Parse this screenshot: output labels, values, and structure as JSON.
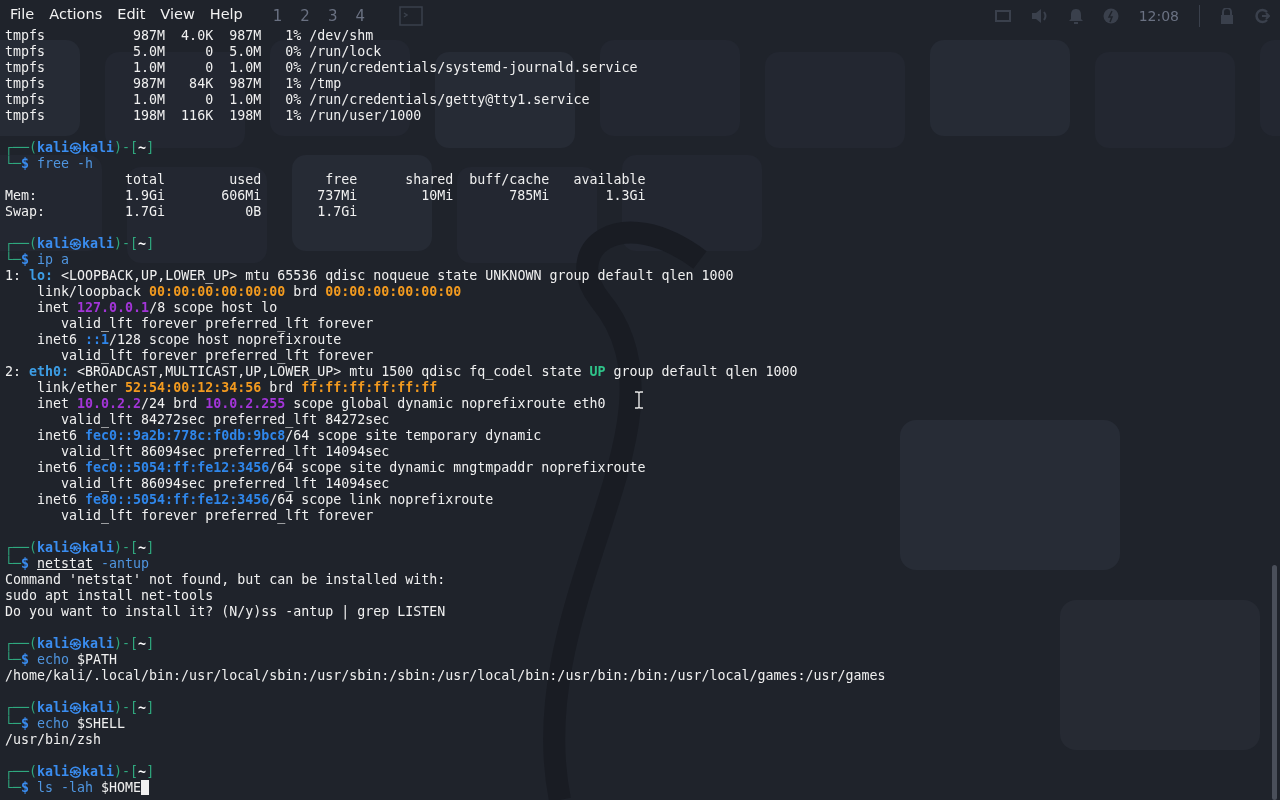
{
  "menu": [
    {
      "label": "File"
    },
    {
      "label": "Actions"
    },
    {
      "label": "Edit"
    },
    {
      "label": "View"
    },
    {
      "label": "Help"
    }
  ],
  "panel": {
    "workspaces": [
      "1",
      "2",
      "3",
      "4"
    ],
    "clock": "12:08"
  },
  "terminal": {
    "blocks": [
      {
        "lines": [
          {
            "segments": [
              {
                "text": "tmpfs           987M  4.0K  987M   1% /dev/shm",
                "kind": "plain"
              }
            ]
          },
          {
            "segments": [
              {
                "text": "tmpfs           5.0M     0  5.0M   0% /run/lock",
                "kind": "plain"
              }
            ]
          },
          {
            "segments": [
              {
                "text": "tmpfs           1.0M     0  1.0M   0% /run/credentials/systemd-journald.service",
                "kind": "plain"
              }
            ]
          },
          {
            "segments": [
              {
                "text": "tmpfs           987M   84K  987M   1% /tmp",
                "kind": "plain"
              }
            ]
          },
          {
            "segments": [
              {
                "text": "tmpfs           1.0M     0  1.0M   0% /run/credentials/getty@tty1.service",
                "kind": "plain"
              }
            ]
          },
          {
            "segments": [
              {
                "text": "tmpfs           198M  116K  198M   1% /run/user/1000",
                "kind": "plain"
              }
            ]
          }
        ]
      },
      {
        "lines": [
          {
            "segments": [
              {
                "text": "┌──(",
                "kind": "frame"
              },
              {
                "text": "kali㉿kali",
                "kind": "user"
              },
              {
                "text": ")-[",
                "kind": "frame"
              },
              {
                "text": "~",
                "kind": "dir"
              },
              {
                "text": "]",
                "kind": "frame"
              }
            ]
          },
          {
            "segments": [
              {
                "text": "└─",
                "kind": "frame"
              },
              {
                "text": "$ ",
                "kind": "dollar"
              },
              {
                "text": "free -h",
                "kind": "cmd"
              }
            ]
          },
          {
            "segments": [
              {
                "text": "               total        used        free      shared  buff/cache   available",
                "kind": "plain"
              }
            ]
          },
          {
            "segments": [
              {
                "text": "Mem:           1.9Gi       606Mi       737Mi        10Mi       785Mi       1.3Gi",
                "kind": "plain"
              }
            ]
          },
          {
            "segments": [
              {
                "text": "Swap:          1.7Gi          0B       1.7Gi",
                "kind": "plain"
              }
            ]
          }
        ]
      },
      {
        "lines": [
          {
            "segments": [
              {
                "text": "┌──(",
                "kind": "frame"
              },
              {
                "text": "kali㉿kali",
                "kind": "user"
              },
              {
                "text": ")-[",
                "kind": "frame"
              },
              {
                "text": "~",
                "kind": "dir"
              },
              {
                "text": "]",
                "kind": "frame"
              }
            ]
          },
          {
            "segments": [
              {
                "text": "└─",
                "kind": "frame"
              },
              {
                "text": "$ ",
                "kind": "dollar"
              },
              {
                "text": "ip a",
                "kind": "cmd"
              }
            ]
          },
          {
            "segments": [
              {
                "text": "1: ",
                "kind": "plain"
              },
              {
                "text": "lo:",
                "kind": "iface"
              },
              {
                "text": " <LOOPBACK,UP,LOWER_UP> mtu 65536 qdisc noqueue state UNKNOWN group default qlen 1000",
                "kind": "plain"
              }
            ]
          },
          {
            "segments": [
              {
                "text": "    link/loopback ",
                "kind": "plain"
              },
              {
                "text": "00:00:00:00:00:00",
                "kind": "mac"
              },
              {
                "text": " brd ",
                "kind": "plain"
              },
              {
                "text": "00:00:00:00:00:00",
                "kind": "mac"
              }
            ]
          },
          {
            "segments": [
              {
                "text": "    inet ",
                "kind": "plain"
              },
              {
                "text": "127.0.0.1",
                "kind": "ipv4"
              },
              {
                "text": "/8 scope host lo",
                "kind": "plain"
              }
            ]
          },
          {
            "segments": [
              {
                "text": "       valid_lft forever preferred_lft forever",
                "kind": "plain"
              }
            ]
          },
          {
            "segments": [
              {
                "text": "    inet6 ",
                "kind": "plain"
              },
              {
                "text": "::1",
                "kind": "ipv6"
              },
              {
                "text": "/128 scope host noprefixroute",
                "kind": "plain"
              }
            ]
          },
          {
            "segments": [
              {
                "text": "       valid_lft forever preferred_lft forever",
                "kind": "plain"
              }
            ]
          },
          {
            "segments": [
              {
                "text": "2: ",
                "kind": "plain"
              },
              {
                "text": "eth0:",
                "kind": "iface"
              },
              {
                "text": " <BROADCAST,MULTICAST,UP,LOWER_UP> mtu 1500 qdisc fq_codel state ",
                "kind": "plain"
              },
              {
                "text": "UP",
                "kind": "up"
              },
              {
                "text": " group default qlen 1000",
                "kind": "plain"
              }
            ]
          },
          {
            "segments": [
              {
                "text": "    link/ether ",
                "kind": "plain"
              },
              {
                "text": "52:54:00:12:34:56",
                "kind": "mac"
              },
              {
                "text": " brd ",
                "kind": "plain"
              },
              {
                "text": "ff:ff:ff:ff:ff:ff",
                "kind": "mac"
              }
            ]
          },
          {
            "segments": [
              {
                "text": "    inet ",
                "kind": "plain"
              },
              {
                "text": "10.0.2.2",
                "kind": "ipv4"
              },
              {
                "text": "/24 brd ",
                "kind": "plain"
              },
              {
                "text": "10.0.2.255",
                "kind": "ipv4"
              },
              {
                "text": " scope global dynamic noprefixroute eth0",
                "kind": "plain"
              }
            ]
          },
          {
            "segments": [
              {
                "text": "       valid_lft 84272sec preferred_lft 84272sec",
                "kind": "plain"
              }
            ]
          },
          {
            "segments": [
              {
                "text": "    inet6 ",
                "kind": "plain"
              },
              {
                "text": "fec0::9a2b:778c:f0db:9bc8",
                "kind": "ipv6"
              },
              {
                "text": "/64 scope site temporary dynamic",
                "kind": "plain"
              }
            ]
          },
          {
            "segments": [
              {
                "text": "       valid_lft 86094sec preferred_lft 14094sec",
                "kind": "plain"
              }
            ]
          },
          {
            "segments": [
              {
                "text": "    inet6 ",
                "kind": "plain"
              },
              {
                "text": "fec0::5054:ff:fe12:3456",
                "kind": "ipv6"
              },
              {
                "text": "/64 scope site dynamic mngtmpaddr noprefixroute",
                "kind": "plain"
              }
            ]
          },
          {
            "segments": [
              {
                "text": "       valid_lft 86094sec preferred_lft 14094sec",
                "kind": "plain"
              }
            ]
          },
          {
            "segments": [
              {
                "text": "    inet6 ",
                "kind": "plain"
              },
              {
                "text": "fe80::5054:ff:fe12:3456",
                "kind": "ipv6"
              },
              {
                "text": "/64 scope link noprefixroute",
                "kind": "plain"
              }
            ]
          },
          {
            "segments": [
              {
                "text": "       valid_lft forever preferred_lft forever",
                "kind": "plain"
              }
            ]
          }
        ]
      },
      {
        "lines": [
          {
            "segments": [
              {
                "text": "┌──(",
                "kind": "frame"
              },
              {
                "text": "kali㉿kali",
                "kind": "user"
              },
              {
                "text": ")-[",
                "kind": "frame"
              },
              {
                "text": "~",
                "kind": "dir"
              },
              {
                "text": "]",
                "kind": "frame"
              }
            ]
          },
          {
            "segments": [
              {
                "text": "└─",
                "kind": "frame"
              },
              {
                "text": "$ ",
                "kind": "dollar"
              },
              {
                "text": "netstat",
                "kind": "missing"
              },
              {
                "text": " -antup",
                "kind": "cmd"
              }
            ]
          },
          {
            "segments": [
              {
                "text": "Command 'netstat' not found, but can be installed with:",
                "kind": "plain"
              }
            ]
          },
          {
            "segments": [
              {
                "text": "sudo apt install net-tools",
                "kind": "plain"
              }
            ]
          },
          {
            "segments": [
              {
                "text": "Do you want to install it? (N/y)ss -antup | grep LISTEN",
                "kind": "plain"
              }
            ]
          }
        ]
      },
      {
        "lines": [
          {
            "segments": [
              {
                "text": "┌──(",
                "kind": "frame"
              },
              {
                "text": "kali㉿kali",
                "kind": "user"
              },
              {
                "text": ")-[",
                "kind": "frame"
              },
              {
                "text": "~",
                "kind": "dir"
              },
              {
                "text": "]",
                "kind": "frame"
              }
            ]
          },
          {
            "segments": [
              {
                "text": "└─",
                "kind": "frame"
              },
              {
                "text": "$ ",
                "kind": "dollar"
              },
              {
                "text": "echo",
                "kind": "cmd"
              },
              {
                "text": " $PATH",
                "kind": "var"
              }
            ]
          },
          {
            "segments": [
              {
                "text": "/home/kali/.local/bin:/usr/local/sbin:/usr/sbin:/sbin:/usr/local/bin:/usr/bin:/bin:/usr/local/games:/usr/games",
                "kind": "plain"
              }
            ]
          }
        ]
      },
      {
        "lines": [
          {
            "segments": [
              {
                "text": "┌──(",
                "kind": "frame"
              },
              {
                "text": "kali㉿kali",
                "kind": "user"
              },
              {
                "text": ")-[",
                "kind": "frame"
              },
              {
                "text": "~",
                "kind": "dir"
              },
              {
                "text": "]",
                "kind": "frame"
              }
            ]
          },
          {
            "segments": [
              {
                "text": "└─",
                "kind": "frame"
              },
              {
                "text": "$ ",
                "kind": "dollar"
              },
              {
                "text": "echo",
                "kind": "cmd"
              },
              {
                "text": " $SHELL",
                "kind": "var"
              }
            ]
          },
          {
            "segments": [
              {
                "text": "/usr/bin/zsh",
                "kind": "plain"
              }
            ]
          }
        ]
      },
      {
        "lines": [
          {
            "segments": [
              {
                "text": "┌──(",
                "kind": "frame"
              },
              {
                "text": "kali㉿kali",
                "kind": "user"
              },
              {
                "text": ")-[",
                "kind": "frame"
              },
              {
                "text": "~",
                "kind": "dir"
              },
              {
                "text": "]",
                "kind": "frame"
              }
            ]
          },
          {
            "segments": [
              {
                "text": "└─",
                "kind": "frame"
              },
              {
                "text": "$ ",
                "kind": "dollar"
              },
              {
                "text": "ls -lah",
                "kind": "cmd"
              },
              {
                "text": " $HOME",
                "kind": "var"
              }
            ]
          }
        ]
      }
    ]
  }
}
